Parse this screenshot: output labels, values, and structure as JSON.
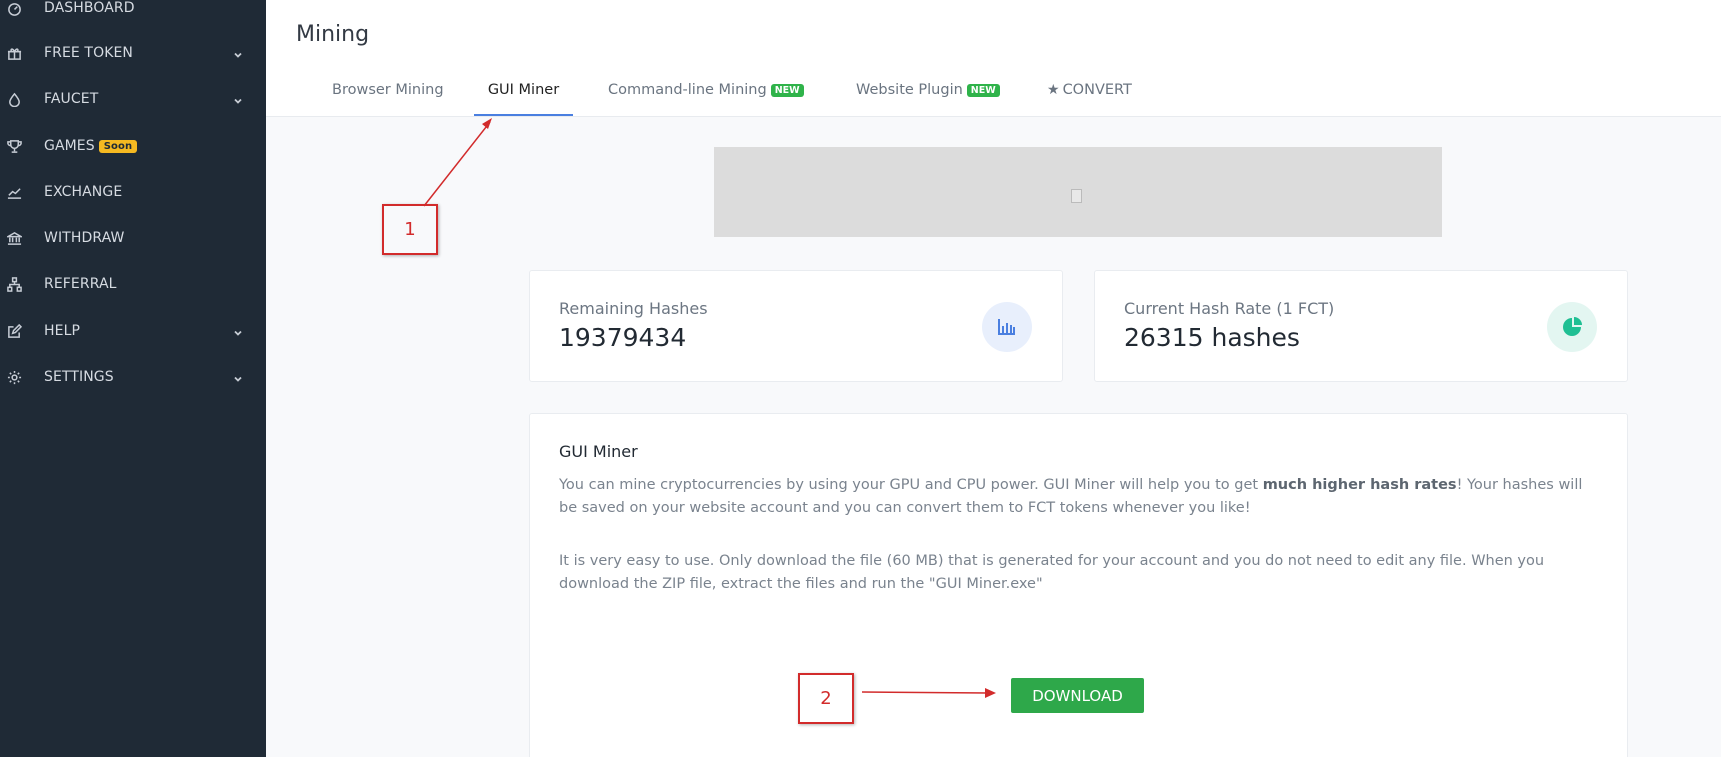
{
  "sidebar": {
    "items": [
      {
        "label": "DASHBOARD",
        "icon": "dashboard-icon",
        "has_chevron": false
      },
      {
        "label": "FREE TOKEN",
        "icon": "gift-icon",
        "has_chevron": true
      },
      {
        "label": "FAUCET",
        "icon": "droplet-icon",
        "has_chevron": true
      },
      {
        "label": "GAMES",
        "icon": "trophy-icon",
        "has_chevron": false,
        "badge": "Soon"
      },
      {
        "label": "EXCHANGE",
        "icon": "chart-line-icon",
        "has_chevron": false
      },
      {
        "label": "WITHDRAW",
        "icon": "bank-icon",
        "has_chevron": false
      },
      {
        "label": "REFERRAL",
        "icon": "sitemap-icon",
        "has_chevron": false
      },
      {
        "label": "HELP",
        "icon": "edit-icon",
        "has_chevron": true
      },
      {
        "label": "SETTINGS",
        "icon": "gear-icon",
        "has_chevron": true
      }
    ]
  },
  "header": {
    "title": "Mining",
    "tabs": [
      {
        "label": "Browser Mining",
        "active": false
      },
      {
        "label": "GUI Miner",
        "active": true
      },
      {
        "label": "Command-line Mining",
        "badge": "NEW",
        "active": false
      },
      {
        "label": "Website Plugin",
        "badge": "NEW",
        "active": false
      },
      {
        "label": "CONVERT",
        "icon": "star-icon",
        "active": false
      }
    ]
  },
  "stats": {
    "remaining": {
      "label": "Remaining Hashes",
      "value": "19379434",
      "icon": "bar-chart-icon"
    },
    "hashrate": {
      "label": "Current Hash Rate (1 FCT)",
      "value": "26315 hashes",
      "icon": "pie-chart-icon"
    }
  },
  "content": {
    "title": "GUI Miner",
    "p1_a": "You can mine cryptocurrencies by using your GPU and CPU power. GUI Miner will help you to get ",
    "p1_bold": "much higher hash rates",
    "p1_b": "! Your hashes will be saved on your website account and you can convert them to FCT tokens whenever you like!",
    "p2": "It is very easy to use. Only download the file (60 MB) that is generated for your account and you do not need to edit any file. When you download the ZIP file, extract the files and run the \"GUI Miner.exe\"",
    "download_label": "DOWNLOAD"
  },
  "annotations": {
    "one": "1",
    "two": "2"
  },
  "colors": {
    "sidebar_bg": "#1f2a36",
    "active_tab": "#4a7fe0",
    "badge_new": "#2fb34a",
    "badge_soon": "#f5b921",
    "download": "#2ea84a",
    "annotation": "#d22b2b"
  }
}
